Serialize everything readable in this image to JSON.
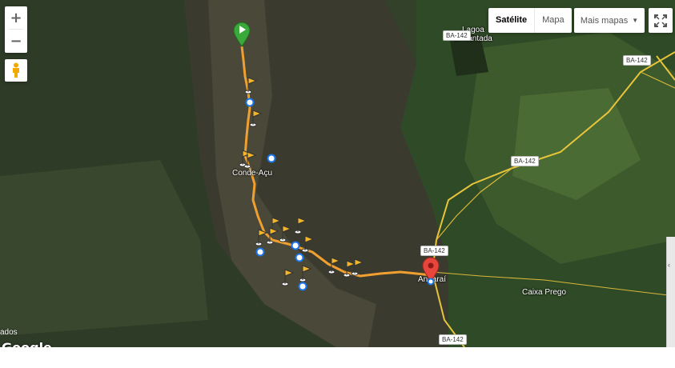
{
  "controls": {
    "zoom_in": "+",
    "zoom_out": "−",
    "map_types": [
      {
        "label": "Satélite",
        "selected": true
      },
      {
        "label": "Mapa",
        "selected": false
      }
    ],
    "more_maps": "Mais mapas",
    "fullscreen_icon": "fullscreen-icon",
    "pegman_icon": "pegman-icon"
  },
  "places": [
    {
      "id": "lagoa",
      "line1": "Lagoa",
      "line2": "Encantada"
    },
    {
      "id": "conde",
      "line1": "Conde-Açu"
    },
    {
      "id": "andarai",
      "line1": "Andaraí"
    },
    {
      "id": "caixa",
      "line1": "Caixa Prego"
    }
  ],
  "roads": [
    "BA-142",
    "BA-142",
    "BA-142",
    "BA-142",
    "BA-142"
  ],
  "cut_label": "ados",
  "logo": "Google",
  "colors": {
    "track": "#f0a030",
    "road": "#e8c43a",
    "start_marker": "#3aa83a",
    "end_marker": "#e8453c",
    "flag": "#f3b52a"
  },
  "markers": {
    "start": "start-marker-icon",
    "end": "end-marker-icon",
    "waypoint": "waypoint-flag-icon",
    "photo": "photo-point-icon"
  }
}
